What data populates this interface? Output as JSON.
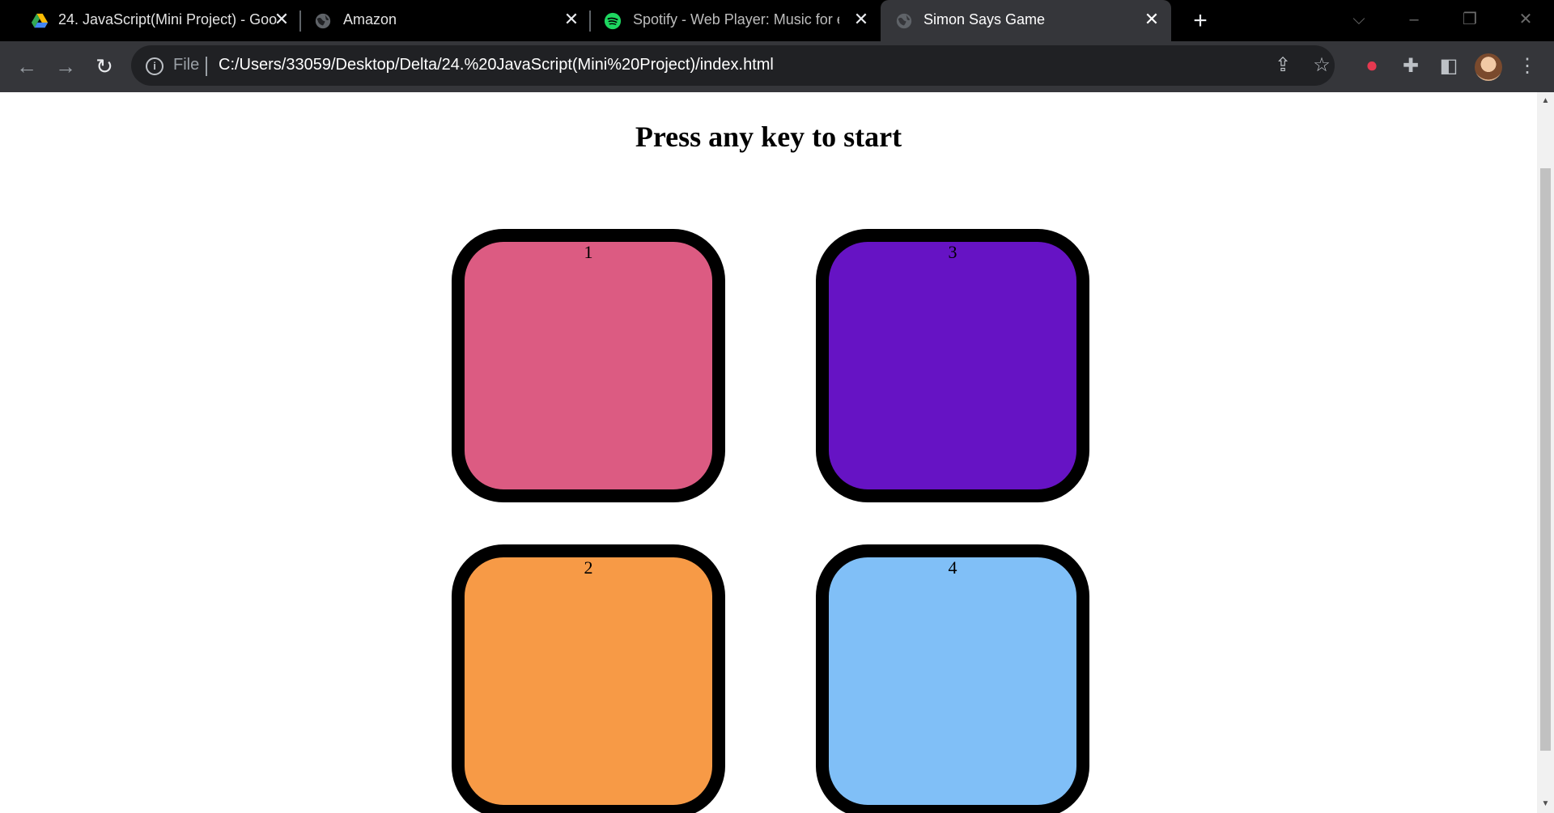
{
  "browser": {
    "tabs": [
      {
        "title": "24. JavaScript(Mini Project) - Goo",
        "icon": "google-drive-icon"
      },
      {
        "title": "Amazon",
        "icon": "globe-icon"
      },
      {
        "title": "Spotify - Web Player: Music for ev",
        "icon": "spotify-icon"
      },
      {
        "title": "Simon Says Game",
        "icon": "globe-icon",
        "active": true
      }
    ],
    "new_tab": "+",
    "address": {
      "scheme_label": "File",
      "url": "C:/Users/33059/Desktop/Delta/24.%20JavaScript(Mini%20Project)/index.html"
    }
  },
  "page": {
    "heading": "Press any key to start",
    "buttons": [
      {
        "label": "1",
        "color": "#dc5b82"
      },
      {
        "label": "3",
        "color": "#6613c4"
      },
      {
        "label": "2",
        "color": "#f79a46"
      },
      {
        "label": "4",
        "color": "#80bff7"
      }
    ]
  },
  "colors": {
    "tabstrip": "#000000",
    "toolbar": "#35363a",
    "omnibox": "#202124"
  }
}
